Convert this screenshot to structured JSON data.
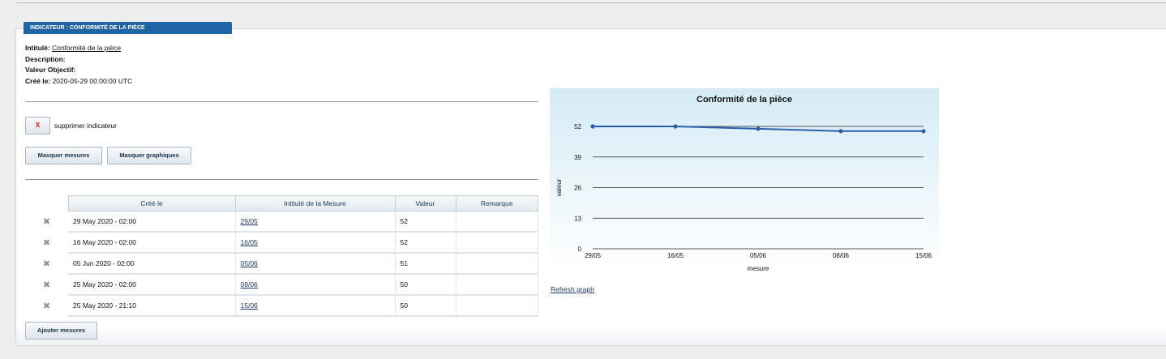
{
  "indicator": {
    "title_tab": "INDICATEUR : CONFORMITÉ DE LA PIÈCE",
    "intitule_label": "Intitulé:",
    "intitule_value": "Conformité de la pièce",
    "description_label": "Description:",
    "objectif_label": "Valeur Objectif:",
    "cree_label": "Créé le:",
    "cree_value": "2020-05-29 00:00:00 UTC"
  },
  "actions": {
    "delete_icon": "X",
    "delete_label": "supprimer indicateur",
    "hide_measures": "Masquer mesures",
    "hide_graphs": "Masquer graphiques",
    "add_measures": "Ajouter mesures"
  },
  "table": {
    "headers": [
      "Créé le",
      "Intitulé de la Mesure",
      "Valeur",
      "Remarque"
    ],
    "rows": [
      {
        "created": "29 May 2020 - 02:00",
        "name": "29/05",
        "value": "52",
        "remark": ""
      },
      {
        "created": "16 May 2020 - 02:00",
        "name": "16/05",
        "value": "52",
        "remark": ""
      },
      {
        "created": "05 Jun 2020 - 02:00",
        "name": "05/06",
        "value": "51",
        "remark": ""
      },
      {
        "created": "25 May 2020 - 02:00",
        "name": "08/06",
        "value": "50",
        "remark": ""
      },
      {
        "created": "25 May 2020 - 21:10",
        "name": "15/06",
        "value": "50",
        "remark": ""
      }
    ],
    "delete_glyph": "✖"
  },
  "chart_data": {
    "type": "line",
    "title": "Conformité de la pièce",
    "xlabel": "mesure",
    "ylabel": "valeur",
    "categories": [
      "29/05",
      "16/05",
      "05/06",
      "08/06",
      "15/06"
    ],
    "series": [
      {
        "values": [
          52,
          52,
          51,
          50,
          50
        ]
      }
    ],
    "ylim": [
      0,
      52
    ],
    "yticks": [
      0,
      13,
      26,
      39,
      52
    ],
    "grid": true,
    "line_color": "#2a5fb0"
  },
  "refresh_label": "Refresh graph"
}
